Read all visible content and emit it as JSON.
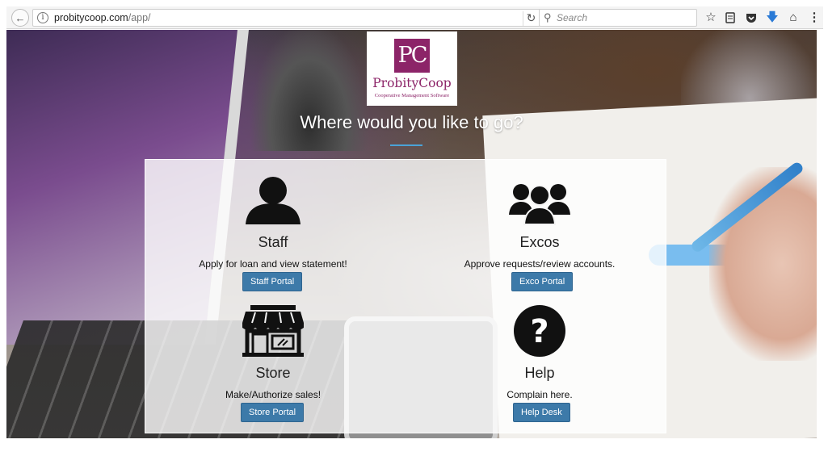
{
  "browser": {
    "url_host": "probitycoop.com",
    "url_path": "/app/",
    "search_placeholder": "Search",
    "icons": [
      "back-arrow-icon",
      "info-icon",
      "reload-icon",
      "search-icon",
      "bookmark-star-icon",
      "reading-list-icon",
      "pocket-icon",
      "download-icon",
      "home-icon",
      "menu-icon"
    ]
  },
  "logo": {
    "mark": "PC",
    "name": "ProbityCoop",
    "tagline": "Cooperative Management Software"
  },
  "heading": "Where would you like to go?",
  "portals": [
    {
      "title": "Staff",
      "description": "Apply for loan and view statement!",
      "button": "Staff Portal",
      "icon": "user-icon"
    },
    {
      "title": "Excos",
      "description": "Approve requests/review accounts.",
      "button": "Exco Portal",
      "icon": "group-icon"
    },
    {
      "title": "Store",
      "description": "Make/Authorize sales!",
      "button": "Store Portal",
      "icon": "storefront-icon"
    },
    {
      "title": "Help",
      "description": "Complain here.",
      "button": "Help Desk",
      "icon": "question-icon"
    }
  ],
  "colors": {
    "brand": "#8c2468",
    "button": "#3d7aa9",
    "accent_rule": "#4aa3d8"
  }
}
